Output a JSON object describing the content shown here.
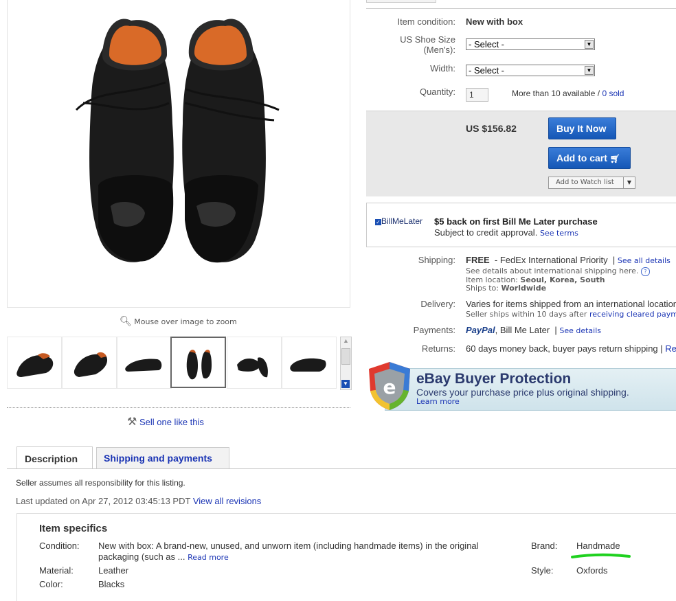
{
  "gallery": {
    "zoom_hint": "Mouse over image to zoom",
    "sell_like": "Sell one like this"
  },
  "details": {
    "condition_label": "Item condition:",
    "condition_value": "New with box",
    "size_label": "US Shoe Size (Men's):",
    "size_select": "- Select -",
    "width_label": "Width:",
    "width_select": "- Select -",
    "quantity_label": "Quantity:",
    "quantity_value": "1",
    "available_text": "More than 10 available /",
    "sold_link": "0 sold"
  },
  "purchase": {
    "price": "US $156.82",
    "buy_now": "Buy It Now",
    "add_to_cart": "Add to cart",
    "watch_list": "Add to Watch list"
  },
  "bill_me_later": {
    "logo": "BillMeLater",
    "headline": "$5 back on first Bill Me Later purchase",
    "subtitle": "Subject to credit approval.",
    "see_terms": "See terms"
  },
  "shipping": {
    "label": "Shipping:",
    "free": "FREE",
    "method": "- FedEx International Priority",
    "see_all": "See all details",
    "intl_note": "See details about international shipping here.",
    "location_label": "Item location:",
    "location": "Seoul, Korea, South",
    "ships_to_label": "Ships to:",
    "ships_to": "Worldwide"
  },
  "delivery": {
    "label": "Delivery:",
    "text": "Varies for items shipped from an international location",
    "note": "Seller ships within 10 days after",
    "note_link": "receiving cleared payment"
  },
  "payments": {
    "label": "Payments:",
    "paypal": "PayPal",
    "bml": ", Bill Me Later",
    "see_details": "See details"
  },
  "returns": {
    "label": "Returns:",
    "text": "60 days money back, buyer pays return shipping |",
    "more": "Read"
  },
  "protection": {
    "title": "eBay Buyer Protection",
    "subtitle": "Covers your purchase price plus original shipping.",
    "learn_more": "Learn more"
  },
  "tabs": {
    "description": "Description",
    "shipping": "Shipping and payments"
  },
  "description": {
    "responsibility": "Seller assumes all responsibility for this listing.",
    "updated_prefix": "Last updated on",
    "updated_date": "Apr 27, 2012 03:45:13 PDT",
    "revisions_link": "View all revisions"
  },
  "specifics": {
    "title": "Item specifics",
    "condition_key": "Condition:",
    "condition_val_1": "New with box: A brand-new, unused, and unworn item (including handmade items) in the original",
    "condition_val_2": "packaging (such as ...",
    "read_more": "Read more",
    "material_key": "Material:",
    "material_val": "Leather",
    "color_key": "Color:",
    "color_val": "Blacks",
    "brand_key": "Brand:",
    "brand_val": "Handmade",
    "style_key": "Style:",
    "style_val": "Oxfords"
  },
  "colors": {
    "link": "#1a34b4",
    "button_blue": "#1f63c6",
    "highlight_underline": "#1fd11f"
  }
}
